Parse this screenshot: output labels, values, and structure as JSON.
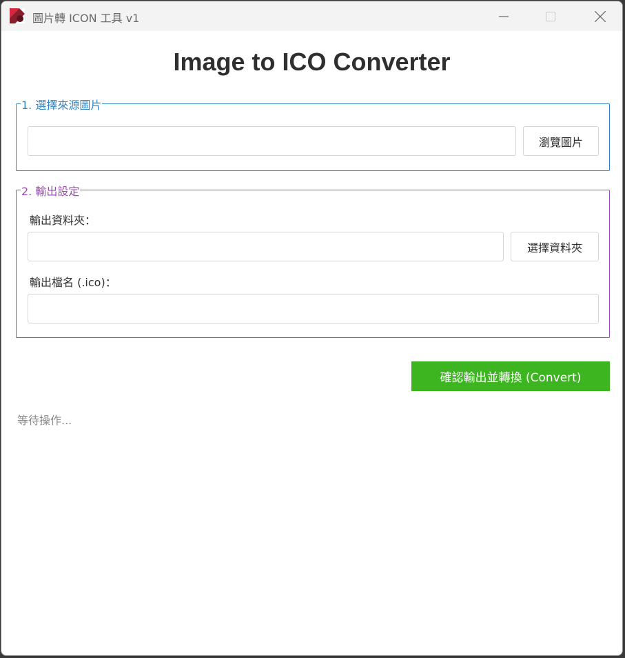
{
  "window": {
    "title": "圖片轉 ICON 工具 v1",
    "icons": {
      "minimize": "minimize-icon",
      "maximize": "maximize-icon",
      "close": "close-icon"
    }
  },
  "heading": "Image to ICO Converter",
  "source_group": {
    "legend": "1. 選擇來源圖片",
    "path_value": "",
    "browse_label": "瀏覽圖片"
  },
  "output_group": {
    "legend": "2. 輸出設定",
    "folder_label": "輸出資料夾：",
    "folder_value": "",
    "choose_folder_label": "選擇資料夾",
    "filename_label": "輸出檔名 (.ico)：",
    "filename_value": ""
  },
  "convert_label": "確認輸出並轉換 (Convert)",
  "status": "等待操作...",
  "colors": {
    "source_group_accent": "#2f86c5",
    "output_group_accent": "#9b4db0",
    "convert_button": "#3cb521"
  }
}
